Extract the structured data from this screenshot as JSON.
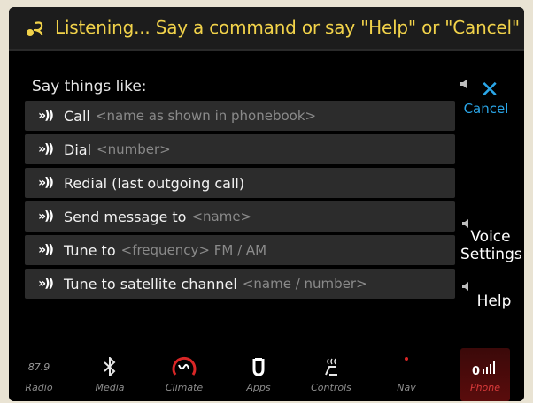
{
  "header": {
    "status_text": "Listening... Say a command or say \"Help\" or \"Cancel\""
  },
  "main": {
    "hint": "Say things like:",
    "commands": [
      {
        "label": "Call",
        "param": "<name as shown in phonebook>"
      },
      {
        "label": "Dial",
        "param": "<number>"
      },
      {
        "label": "Redial (last outgoing call)",
        "param": ""
      },
      {
        "label": "Send message to",
        "param": "<name>"
      },
      {
        "label": "Tune to",
        "param": "<frequency> FM / AM"
      },
      {
        "label": "Tune to satellite channel",
        "param": "<name / number>"
      }
    ]
  },
  "side": {
    "cancel_label": "Cancel",
    "voice_settings_label_1": "Voice",
    "voice_settings_label_2": "Settings",
    "help_label": "Help"
  },
  "nav": {
    "radio_freq": "87.9",
    "radio_label": "Radio",
    "media_label": "Media",
    "climate_label": "Climate",
    "apps_label": "Apps",
    "controls_label": "Controls",
    "nav_label": "Nav",
    "phone_label": "Phone"
  },
  "colors": {
    "prompt_yellow": "#f1d24a",
    "accent_blue": "#2aa6e8",
    "phone_red": "#d93a3a"
  }
}
